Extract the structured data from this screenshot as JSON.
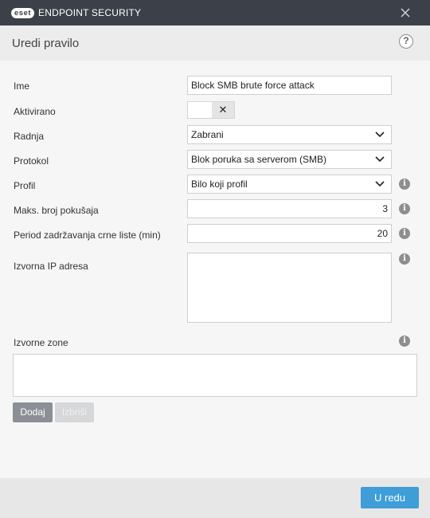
{
  "window": {
    "logo_badge": "eset",
    "product_name": "ENDPOINT SECURITY"
  },
  "header": {
    "title": "Uredi pravilo",
    "help_glyph": "?"
  },
  "form": {
    "name": {
      "label": "Ime",
      "value": "Block SMB brute force attack"
    },
    "enabled": {
      "label": "Aktivirano",
      "state": "off",
      "glyph": "✕"
    },
    "action": {
      "label": "Radnja",
      "value": "Zabrani"
    },
    "protocol": {
      "label": "Protokol",
      "value": "Blok poruka sa serverom (SMB)"
    },
    "profile": {
      "label": "Profil",
      "value": "Bilo koji profil"
    },
    "max_attempts": {
      "label": "Maks. broj pokušaja",
      "value": "3"
    },
    "blacklist_period": {
      "label": "Period zadržavanja crne liste (min)",
      "value": "20"
    },
    "source_ip": {
      "label": "Izvorna IP adresa",
      "value": ""
    },
    "source_zones": {
      "label": "Izvorne zone"
    }
  },
  "info_glyph": "i",
  "buttons": {
    "add": "Dodaj",
    "delete": "Izbriši",
    "ok": "U redu"
  },
  "colors": {
    "titlebar": "#3c4149",
    "primary_button": "#3f9dd8",
    "secondary_button": "#8a9096"
  }
}
